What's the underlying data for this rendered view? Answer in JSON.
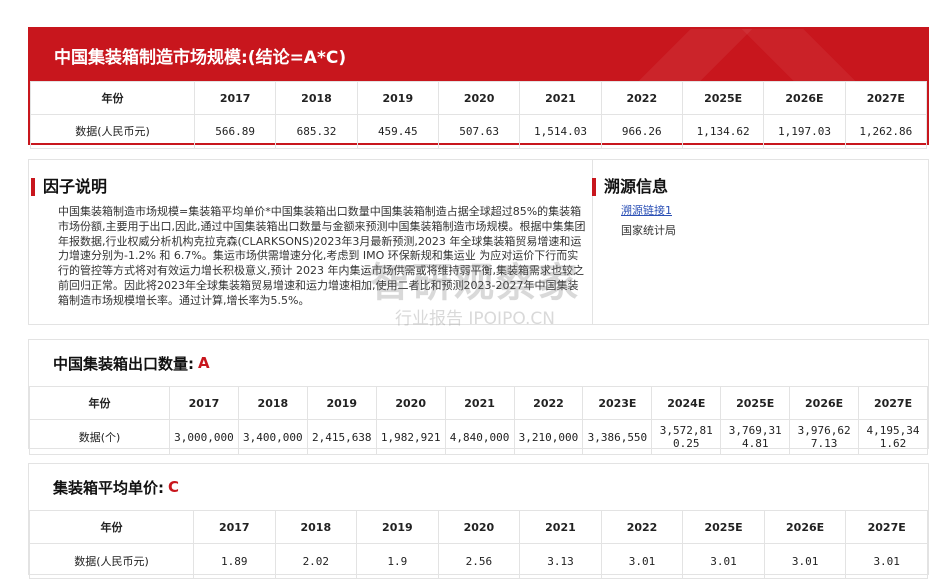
{
  "market": {
    "title": "中国集装箱制造市场规模:(结论=A*C)",
    "header_label": "年份",
    "years": [
      "2017",
      "2018",
      "2019",
      "2020",
      "2021",
      "2022",
      "2025E",
      "2026E",
      "2027E"
    ],
    "row_label": "数据(人民币元)",
    "values": [
      "566.89",
      "685.32",
      "459.45",
      "507.63",
      "1,514.03",
      "966.26",
      "1,134.62",
      "1,197.03",
      "1,262.86"
    ]
  },
  "factor": {
    "title": "因子说明",
    "text": "中国集装箱制造市场规模=集装箱平均单价*中国集装箱出口数量中国集装箱制造占据全球超过85%的集装箱市场份额,主要用于出口,因此,通过中国集装箱出口数量与金额来预测中国集装箱制造市场规模。根据中集集团年报数据,行业权威分析机构克拉克森(CLARKSONS)2023年3月最新预测,2023 年全球集装箱贸易增速和运力增速分别为-1.2% 和 6.7%。集运市场供需增速分化,考虑到 IMO 环保新规和集运业 为应对运价下行而实行的管控等方式将对有效运力增长积极意义,预计 2023 年内集运市场供需或将维持弱平衡,集装箱需求也较之前回归正常。因此将2023年全球集装箱贸易增速和运力增速相加,使用二者比和预测2023-2027年中国集装箱制造市场规模增长率。通过计算,增长率为5.5%。"
  },
  "source": {
    "title": "溯源信息",
    "link_label": "溯源链接1",
    "org": "国家统计局"
  },
  "watermark": {
    "big": "智研观察家",
    "small": "行业报告 IPOIPO.CN"
  },
  "export": {
    "title": "中国集装箱出口数量:",
    "accent": "A",
    "header_label": "年份",
    "years": [
      "2017",
      "2018",
      "2019",
      "2020",
      "2021",
      "2022",
      "2023E",
      "2024E",
      "2025E",
      "2026E",
      "2027E"
    ],
    "row_label": "数据(个)",
    "values": [
      "3,000,000",
      "3,400,000",
      "2,415,638",
      "1,982,921",
      "4,840,000",
      "3,210,000",
      "3,386,550",
      "3,572,810.25",
      "3,769,314.81",
      "3,976,627.13",
      "4,195,341.62"
    ]
  },
  "price": {
    "title": "集装箱平均单价:",
    "accent": "C",
    "header_label": "年份",
    "years": [
      "2017",
      "2018",
      "2019",
      "2020",
      "2021",
      "2022",
      "2025E",
      "2026E",
      "2027E"
    ],
    "row_label": "数据(人民币元)",
    "values": [
      "1.89",
      "2.02",
      "1.9",
      "2.56",
      "3.13",
      "3.01",
      "3.01",
      "3.01",
      "3.01"
    ]
  }
}
